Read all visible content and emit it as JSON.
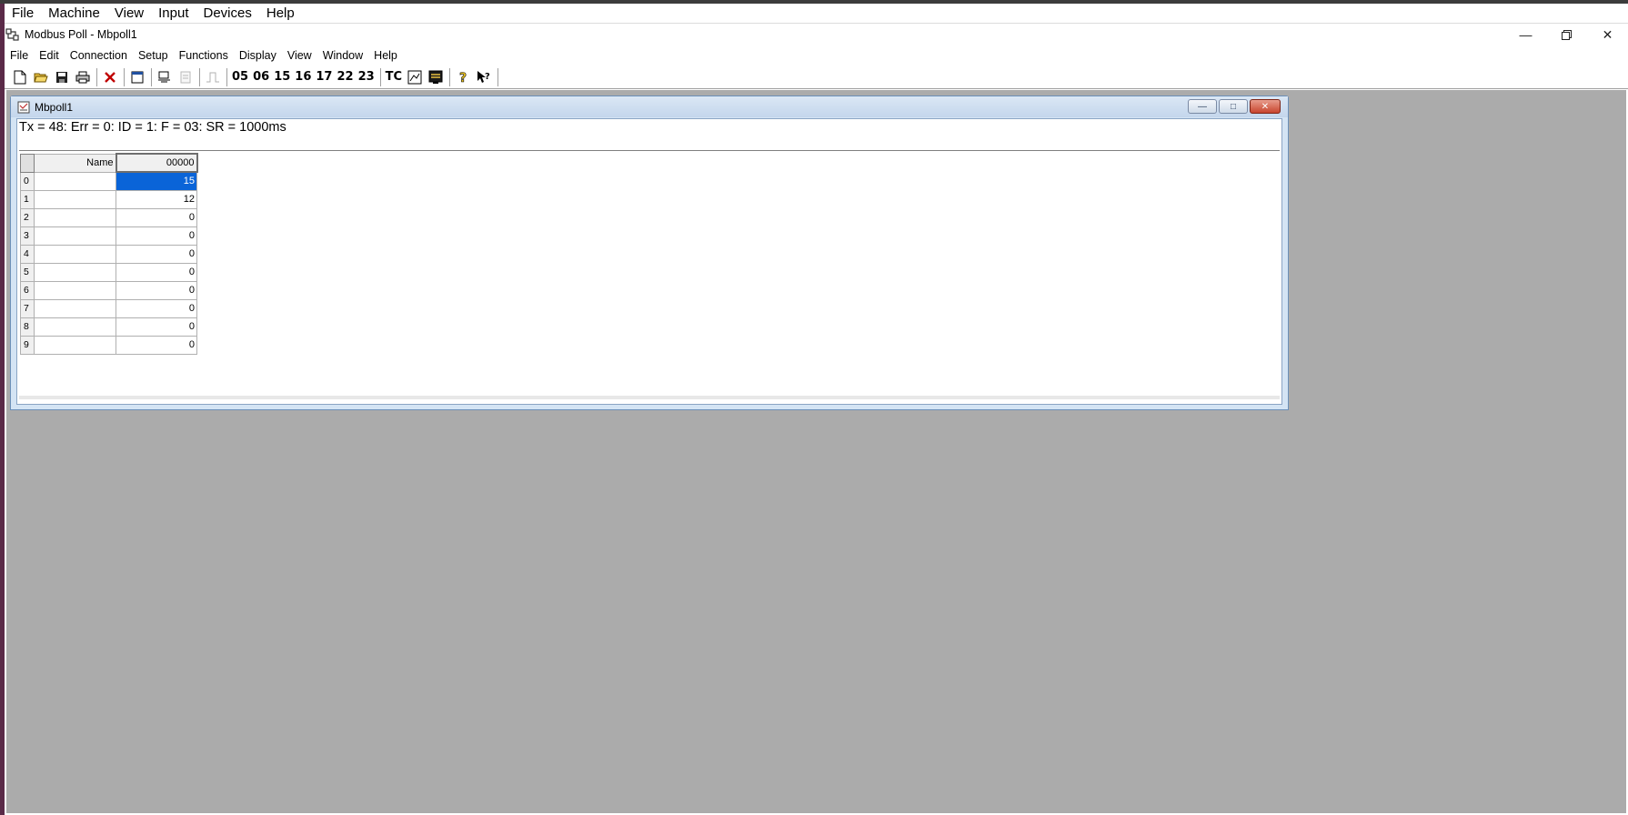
{
  "host": {
    "menu": [
      "File",
      "Machine",
      "View",
      "Input",
      "Devices",
      "Help"
    ]
  },
  "app": {
    "title": "Modbus Poll - Mbpoll1",
    "menu": [
      "File",
      "Edit",
      "Connection",
      "Setup",
      "Functions",
      "Display",
      "View",
      "Window",
      "Help"
    ],
    "toolbar_codes": [
      "05",
      "06",
      "15",
      "16",
      "17",
      "22",
      "23",
      "TC"
    ]
  },
  "child": {
    "title": "Mbpoll1",
    "status": "Tx = 48: Err = 0: ID = 1: F = 03: SR = 1000ms",
    "grid": {
      "name_header": "Name",
      "value_header": "00000",
      "rows": [
        {
          "index": "0",
          "name": "",
          "value": "15"
        },
        {
          "index": "1",
          "name": "",
          "value": "12"
        },
        {
          "index": "2",
          "name": "",
          "value": "0"
        },
        {
          "index": "3",
          "name": "",
          "value": "0"
        },
        {
          "index": "4",
          "name": "",
          "value": "0"
        },
        {
          "index": "5",
          "name": "",
          "value": "0"
        },
        {
          "index": "6",
          "name": "",
          "value": "0"
        },
        {
          "index": "7",
          "name": "",
          "value": "0"
        },
        {
          "index": "8",
          "name": "",
          "value": "0"
        },
        {
          "index": "9",
          "name": "",
          "value": "0"
        }
      ]
    }
  },
  "colors": {
    "mdi_background": "#ababab",
    "selection": "#0a64d8",
    "child_frame": "#d4e4f4"
  }
}
